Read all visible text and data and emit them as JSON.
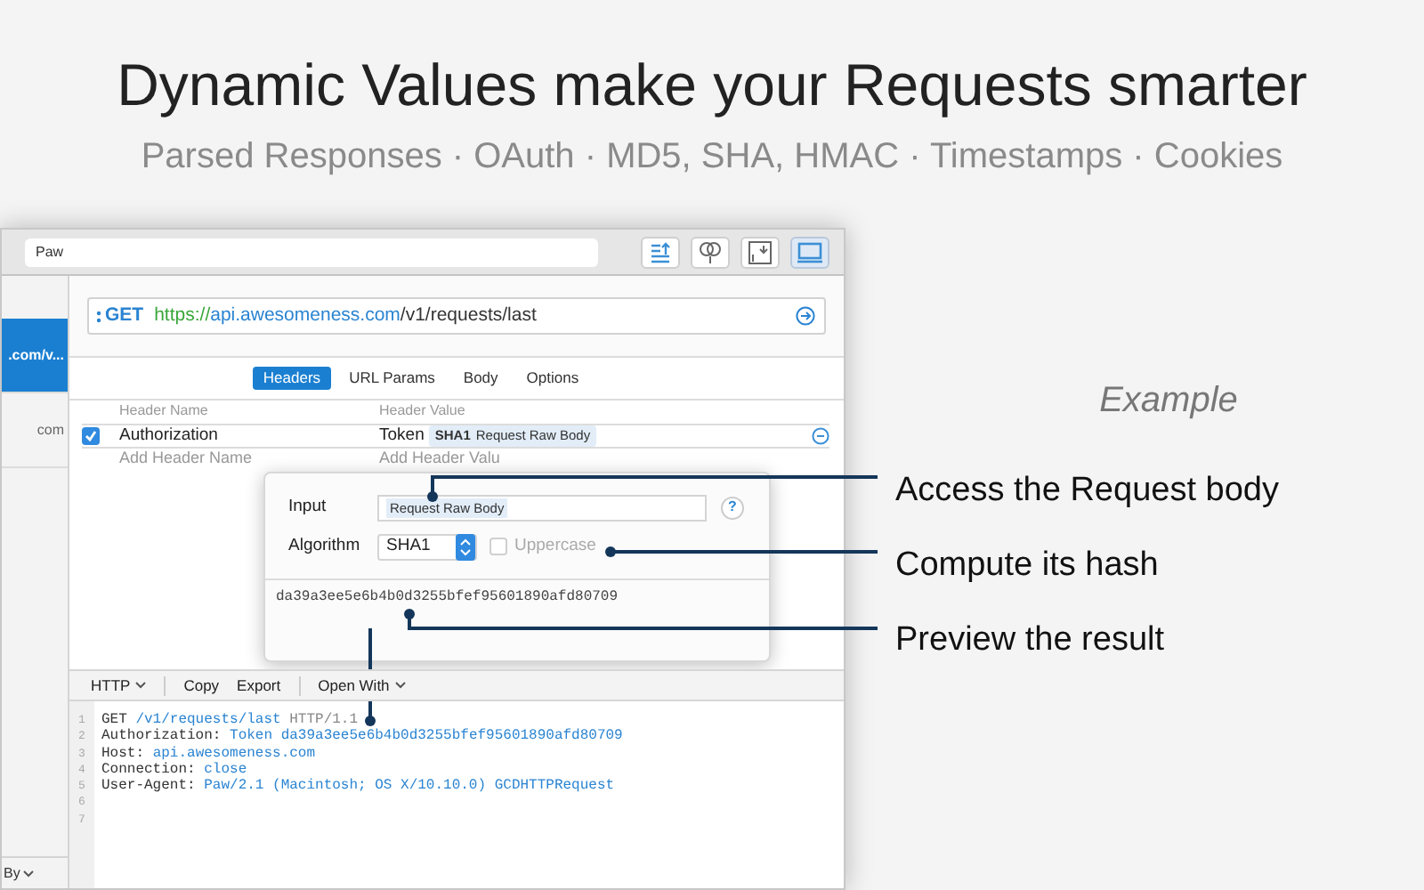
{
  "headline": {
    "title": "Dynamic Values make your Requests smarter",
    "subtitle": "Parsed Responses · OAuth · MD5, SHA, HMAC · Timestamps · Cookies"
  },
  "window": {
    "search": {
      "value": "Paw"
    },
    "sidebar": {
      "items": [
        {
          "label": ".com/v...",
          "selected": true
        },
        {
          "label": "com",
          "selected": false
        }
      ],
      "footer": "By"
    },
    "url_bar": {
      "method": "GET",
      "scheme": "https://",
      "host": "api.awesomeness.com",
      "path": "/v1/requests/last"
    },
    "tabs": [
      {
        "label": "Headers",
        "selected": true
      },
      {
        "label": "URL Params",
        "selected": false
      },
      {
        "label": "Body",
        "selected": false
      },
      {
        "label": "Options",
        "selected": false
      }
    ],
    "headers_table": {
      "columns": [
        "Header Name",
        "Header Value"
      ],
      "rows": [
        {
          "checked": true,
          "name": "Authorization",
          "value": "Token",
          "token": {
            "type": "SHA1",
            "label": "Request Raw Body"
          }
        }
      ],
      "new_row": {
        "name_placeholder": "Add Header Name",
        "value_placeholder": "Add Header Valu"
      }
    },
    "popover": {
      "input_label": "Input",
      "input_token": "Request Raw Body",
      "help": "?",
      "algorithm_label": "Algorithm",
      "algorithm": "SHA1",
      "uppercase": {
        "label": "Uppercase",
        "checked": false,
        "disabled": true
      },
      "result": "da39a3ee5e6b4b0d3255bfef95601890afd80709"
    },
    "bottom_toolbar": [
      {
        "label": "HTTP",
        "dropdown": true
      },
      {
        "label": "Copy",
        "dropdown": false
      },
      {
        "label": "Export",
        "dropdown": false
      },
      {
        "label": "Open With",
        "dropdown": true
      }
    ],
    "code": [
      {
        "number": "1",
        "segments": [
          {
            "text": "GET ",
            "kind": "plain"
          },
          {
            "text": "/v1/requests/last",
            "kind": "value"
          },
          {
            "text": " HTTP/1.1",
            "kind": "muted"
          }
        ]
      },
      {
        "number": "2",
        "segments": [
          {
            "text": "Authorization: ",
            "kind": "plain"
          },
          {
            "text": "Token da39a3ee5e6b4b0d3255bfef95601890afd80709",
            "kind": "value"
          }
        ]
      },
      {
        "number": "3",
        "segments": [
          {
            "text": "Host: ",
            "kind": "plain"
          },
          {
            "text": "api.awesomeness.com",
            "kind": "value"
          }
        ]
      },
      {
        "number": "4",
        "segments": [
          {
            "text": "Connection: ",
            "kind": "plain"
          },
          {
            "text": "close",
            "kind": "value"
          }
        ]
      },
      {
        "number": "5",
        "segments": [
          {
            "text": "User-Agent: ",
            "kind": "plain"
          },
          {
            "text": "Paw/2.1 (Macintosh; OS X/10.10.0) GCDHTTPRequest",
            "kind": "value"
          }
        ]
      },
      {
        "number": "6"
      },
      {
        "number": "7"
      }
    ]
  },
  "example": {
    "heading": "Example",
    "callouts": [
      "Access the Request body",
      "Compute its hash",
      "Preview the result"
    ]
  }
}
